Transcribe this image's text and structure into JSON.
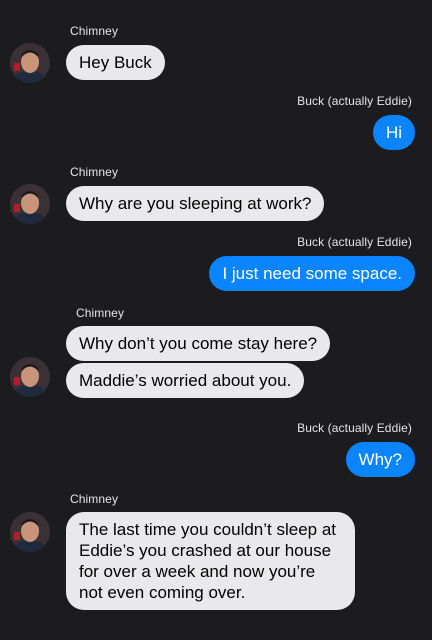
{
  "conversation": {
    "messages": [
      {
        "sender": "Chimney",
        "text": "Hey Buck"
      },
      {
        "sender": "Buck (actually Eddie)",
        "text": "Hi"
      },
      {
        "sender": "Chimney",
        "text": "Why are you sleeping at work?"
      },
      {
        "sender": "Buck (actually Eddie)",
        "text": "I just need some space."
      },
      {
        "sender": "Chimney",
        "text": "Why don’t you come stay here?"
      },
      {
        "sender": "Chimney",
        "text": "Maddie’s worried about you."
      },
      {
        "sender": "Buck (actually Eddie)",
        "text": "Why?"
      },
      {
        "sender": "Chimney",
        "text": "The last time you couldn’t sleep at Eddie’s you crashed at our house for over a week and now you’re not even coming over."
      }
    ]
  },
  "colors": {
    "background": "#1c1c1e",
    "incoming_bubble": "#e9e9eb",
    "outgoing_bubble": "#0a84ff",
    "sender_name": "#e5e5ea"
  },
  "icons": {
    "avatar": "contact-photo-avatar"
  }
}
